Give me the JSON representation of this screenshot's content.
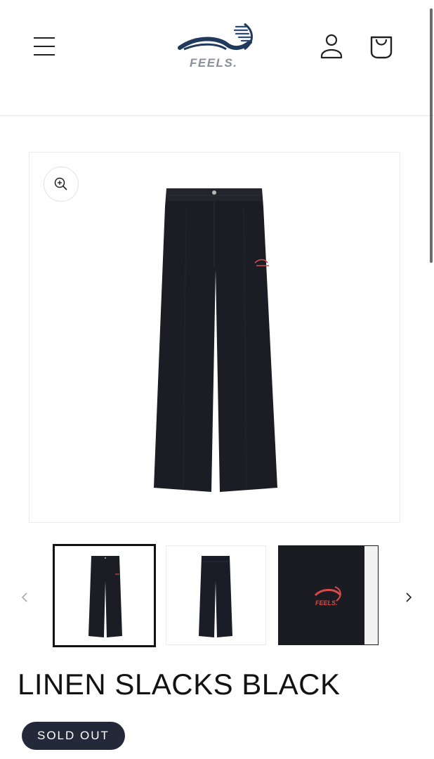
{
  "header": {
    "logo_text": "FEELS."
  },
  "product": {
    "title": "LINEN SLACKS BLACK",
    "status": "SOLD OUT",
    "thumbnails": [
      {
        "alt": "front view",
        "active": true
      },
      {
        "alt": "back view",
        "active": false
      },
      {
        "alt": "logo detail",
        "active": false
      }
    ]
  },
  "icons": {
    "menu": "hamburger-icon",
    "account": "user-icon",
    "cart": "bag-icon",
    "zoom": "zoom-in-icon",
    "prev": "chevron-left-icon",
    "next": "chevron-right-icon"
  },
  "colors": {
    "brand_blue": "#1f3a5c",
    "badge_bg": "#232939",
    "logo_accent": "#d94b4b",
    "garment": "#1c1d24"
  }
}
